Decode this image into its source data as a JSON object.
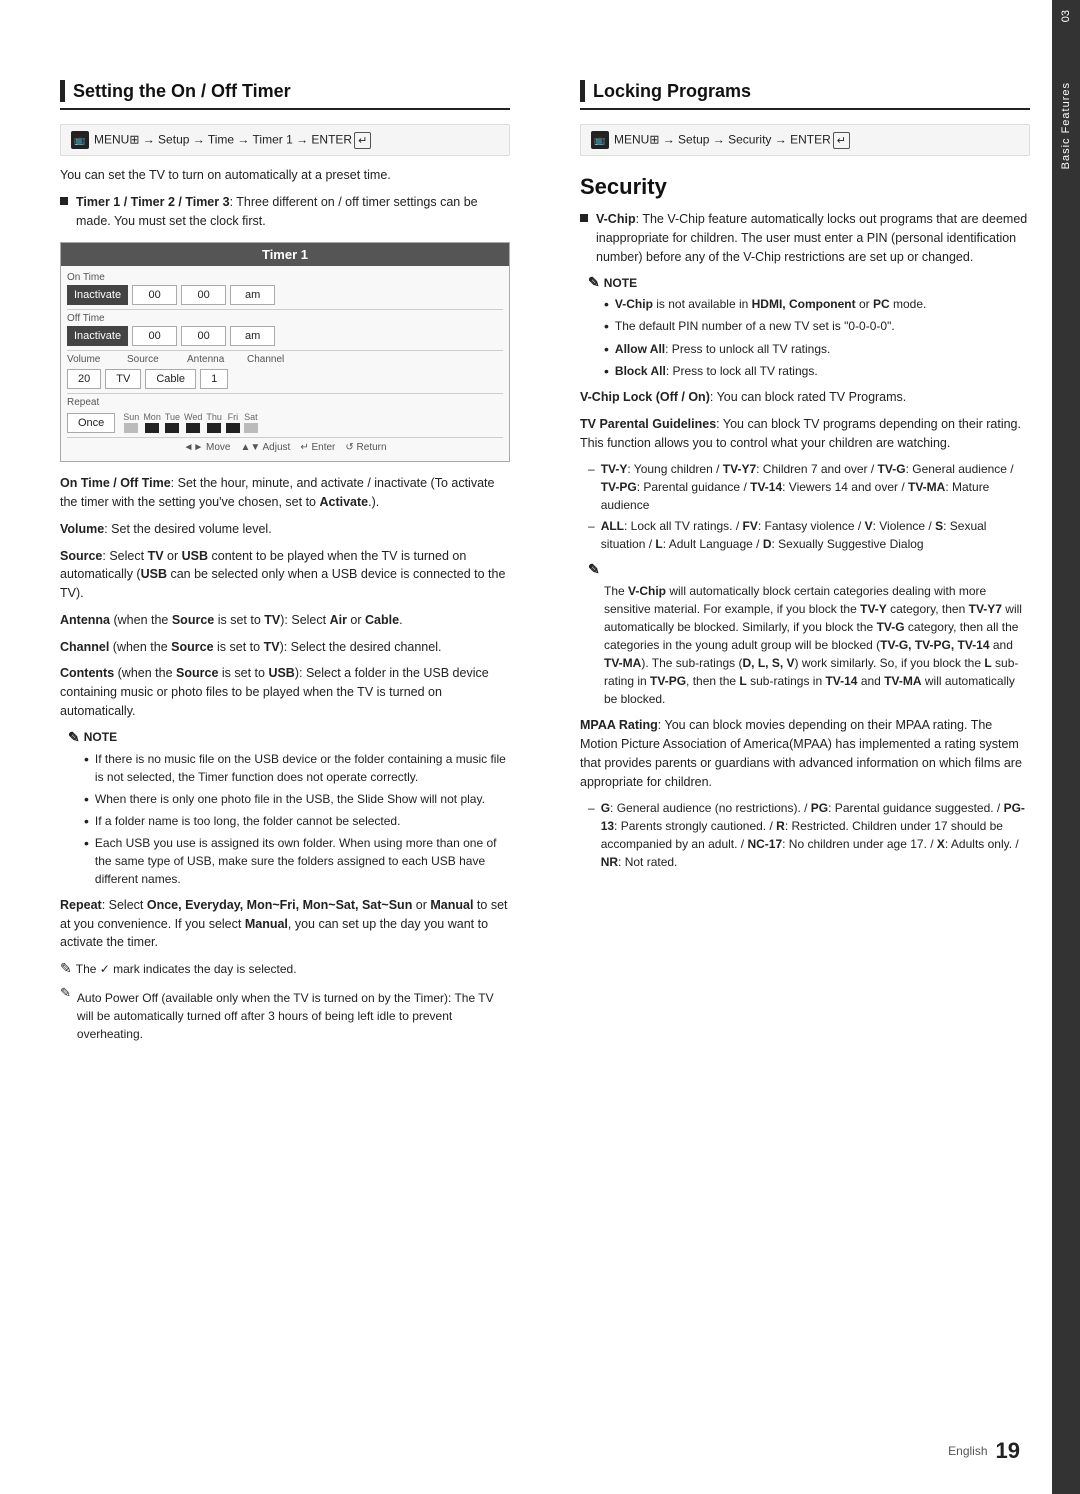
{
  "left_section": {
    "title": "Setting the On / Off Timer",
    "menu_path": "MENU⊞ → Setup → Time → Timer 1 → ENTER↵",
    "intro": "You can set the TV to turn on automatically at a preset time.",
    "timer_box": {
      "title": "Timer 1",
      "on_time_label": "On Time",
      "off_time_label": "Off Time",
      "inactivate": "Inactivate",
      "time_values": [
        "00",
        "00"
      ],
      "am": "am",
      "volume_label": "Volume",
      "volume_value": "20",
      "source_label": "Source",
      "source_value": "TV",
      "antenna_label": "Antenna",
      "antenna_value": "Cable",
      "channel_label": "Channel",
      "channel_value": "1",
      "repeat_label": "Repeat",
      "repeat_value": "Once",
      "days": [
        "Sun",
        "Mon",
        "Tue",
        "Wed",
        "Thu",
        "Fri",
        "Sat"
      ],
      "nav_move": "◄► Move",
      "nav_adjust": "▲▼ Adjust",
      "nav_enter": "↵ Enter",
      "nav_return": "↺ Return"
    },
    "on_off_time_desc": "On Time / Off Time: Set the hour, minute, and activate / inactivate (To activate the timer with the setting you’ve chosen, set to Activate.).",
    "volume_desc": "Volume: Set the desired volume level.",
    "source_desc_1": "Source: Select ",
    "source_desc_tv": "TV",
    "source_desc_2": " or ",
    "source_desc_usb": "USB",
    "source_desc_3": " content to be played when the TV is turned on automatically (",
    "source_desc_usb2": "USB",
    "source_desc_4": " can be selected only when a USB device is connected to the TV).",
    "antenna_desc": "Antenna (when the Source is set to TV): Select Air or Cable.",
    "channel_desc": "Channel (when the Source is set to TV): Select the desired channel.",
    "contents_desc": "Contents (when the Source is set to USB): Select a folder in the USB device containing music or photo files to be played when the TV is turned on automatically.",
    "note_label": "NOTE",
    "notes": [
      "If there is no music file on the USB device or the folder containing a music file is not selected, the Timer function does not operate correctly.",
      "When there is only one photo file in the USB, the Slide Show will not play.",
      "If a folder name is too long, the folder cannot be selected.",
      "Each USB you use is assigned its own folder. When using more than one of the same type of USB, make sure the folders assigned to each USB have different names."
    ],
    "repeat_desc_1": "Repeat: Select ",
    "repeat_bold": "Once, Everyday, Mon~Fri, Mon~Sat, Sat~Sun",
    "repeat_desc_2": " or ",
    "repeat_manual": "Manual",
    "repeat_desc_3": " to set at you convenience. If you select ",
    "repeat_manual2": "Manual",
    "repeat_desc_4": ", you can set up the day you want to activate the timer.",
    "checkmark_note": "The ✓ mark indicates the day is selected.",
    "auto_power_note": "Auto Power Off (available only when the TV is turned on by the Timer): The TV will be automatically turned off after 3 hours of being left idle to prevent overheating."
  },
  "right_section": {
    "title": "Locking Programs",
    "menu_path": "MENU⊞ → Setup → Security → ENTER↵",
    "security_title": "Security",
    "vchip_desc": "V-Chip: The V-Chip feature automatically locks out programs that are deemed inappropriate for children. The user must enter a PIN (personal identification number) before any of the V-Chip restrictions are set up or changed.",
    "note_label": "NOTE",
    "vchip_notes": [
      "V-Chip is not available in HDMI, Component or PC mode.",
      "The default PIN number of a new TV set is “0-0-0-0”.",
      "Allow All: Press to unlock all TV ratings.",
      "Block All: Press to lock all TV ratings."
    ],
    "vchip_lock_desc": "V-Chip Lock (Off / On): You can block rated TV Programs.",
    "tv_parental_desc": "TV Parental Guidelines: You can block TV programs depending on their rating. This function allows you to control what your children are watching.",
    "rating_items": [
      "TV-Y: Young children / TV-Y7: Children 7 and over / TV-G: General audience / TV-PG: Parental guidance / TV-14: Viewers 14 and over / TV-MA: Mature audience",
      "ALL: Lock all TV ratings. / FV: Fantasy violence / V: Violence / S: Sexual situation / L: Adult Language / D: Sexually Suggestive Dialog"
    ],
    "vchip_block_note": "The V-Chip will automatically block certain categories dealing with more sensitive material. For example, if you block the TV-Y category, then TV-Y7 will automatically be blocked. Similarly, if you block the TV-G category, then all the categories in the young adult group will be blocked (TV-G, TV-PG, TV-14 and TV-MA). The sub-ratings (D, L, S, V) work similarly. So, if you block the L sub-rating in TV-PG, then the L sub-ratings in TV-14 and TV-MA will automatically be blocked.",
    "mpaa_desc": "MPAA Rating: You can block movies depending on their MPAA rating. The Motion Picture Association of America(MPAA) has implemented a rating system that provides parents or guardians with advanced information on which films are appropriate for children.",
    "mpaa_items": "G: General audience (no restrictions). / PG: Parental guidance suggested. / PG-13: Parents strongly cautioned. / R: Restricted. Children under 17 should be accompanied by an adult. / NC-17: No children under age 17. / X: Adults only. / NR: Not rated."
  },
  "sidebar": {
    "chapter": "03",
    "label": "Basic Features"
  },
  "footer": {
    "language": "English",
    "page_number": "19"
  }
}
